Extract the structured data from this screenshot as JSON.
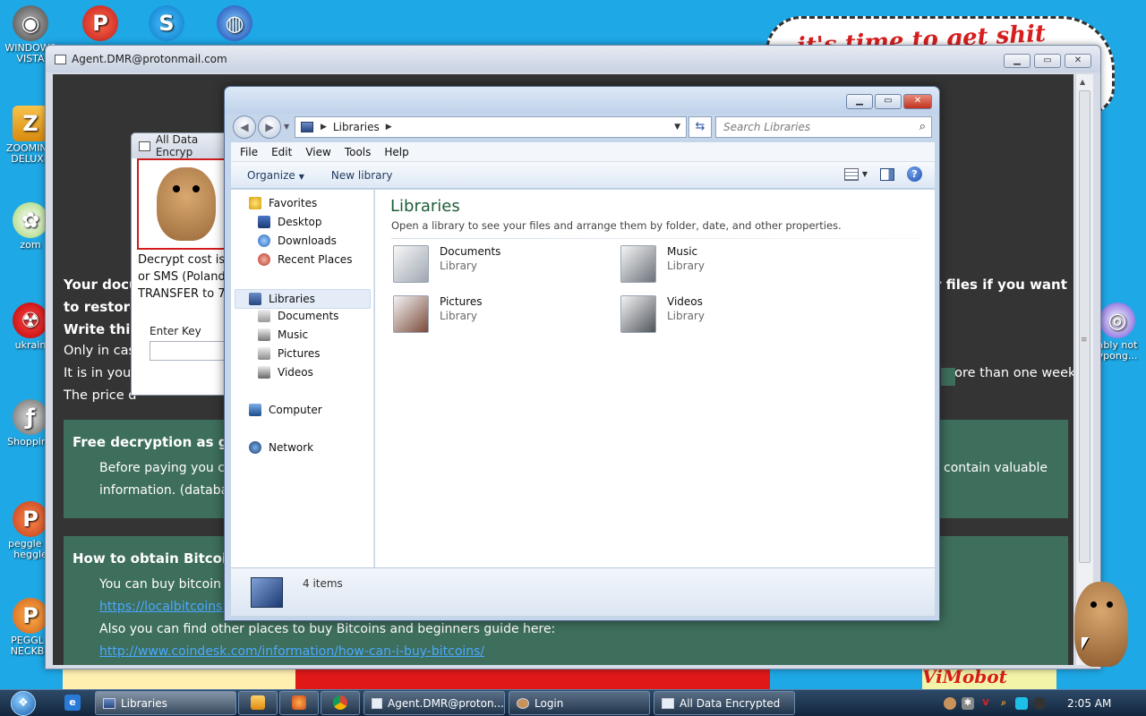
{
  "desktop": {
    "icons": [
      {
        "label": "WINDOWS\nVISTA",
        "name": "windows-vista"
      },
      {
        "label": "",
        "name": "peggle"
      },
      {
        "label": "",
        "name": "skype"
      },
      {
        "label": "",
        "name": "ie-globe"
      },
      {
        "label": "ZOOMING\nDELUXE",
        "name": "zooming-deluxe"
      },
      {
        "label": "zom",
        "name": "zom"
      },
      {
        "label": "ukrain",
        "name": "ukrain"
      },
      {
        "label": "Shopping",
        "name": "shopping"
      },
      {
        "label": "peggle w\nheggle",
        "name": "peggle-heggle"
      },
      {
        "label": "PEGGLE\nNECKBE",
        "name": "peggle-neckbe"
      },
      {
        "label": "ably not\nypong...",
        "name": "ypong"
      }
    ],
    "wallpaper_text_top": "it's time to get shit",
    "wallpaper_text_bottom": "ViMobot"
  },
  "ransom_window": {
    "title": "Agent.DMR@protonmail.com",
    "lines": [
      {
        "text": "Your docu",
        "bold": true
      },
      {
        "text": "to restore",
        "bold": true
      },
      {
        "text": "Write this",
        "bold": true
      },
      {
        "text": "Only in case"
      },
      {
        "text": "It is in your"
      },
      {
        "text": "The price d"
      },
      {
        "text": "r files if you want",
        "bold": true
      },
      {
        "text": "more than one week."
      }
    ],
    "panel1": {
      "heading": "Free decryption as gua",
      "line1": "Before paying you ca",
      "line2": "information. (databas",
      "line1_end": "contain valuable"
    },
    "panel2": {
      "heading": "How to obtain Bitcoins",
      "line1": "You can buy bitcoin fi",
      "link1": "https://localbitcoins.com",
      "line2": "Also you can find other places to buy Bitcoins and beginners guide here:",
      "link2": "http://www.coindesk.com/information/how-can-i-buy-bitcoins/"
    }
  },
  "small_window": {
    "title": "All Data Encryp",
    "text1": "Decrypt cost is 2",
    "text2": "or SMS (Poland",
    "text3": "TRANSFER to 77",
    "enter_key_label": "Enter Key"
  },
  "explorer": {
    "address": "Libraries",
    "search_placeholder": "Search Libraries",
    "menu": [
      "File",
      "Edit",
      "View",
      "Tools",
      "Help"
    ],
    "organize": "Organize",
    "new_library": "New library",
    "nav": {
      "favorites": "Favorites",
      "desktop": "Desktop",
      "downloads": "Downloads",
      "recent": "Recent Places",
      "libraries": "Libraries",
      "documents": "Documents",
      "music": "Music",
      "pictures": "Pictures",
      "videos": "Videos",
      "computer": "Computer",
      "network": "Network"
    },
    "content": {
      "title": "Libraries",
      "subtitle": "Open a library to see your files and arrange them by folder, date, and other properties.",
      "libraries": [
        {
          "name": "Documents",
          "type": "Library"
        },
        {
          "name": "Music",
          "type": "Library"
        },
        {
          "name": "Pictures",
          "type": "Library"
        },
        {
          "name": "Videos",
          "type": "Library"
        }
      ]
    },
    "status": "4 items"
  },
  "taskbar": {
    "tasks": [
      {
        "label": "Libraries",
        "active": true
      },
      {
        "label": "Agent.DMR@proton...",
        "active": false
      },
      {
        "label": "Login",
        "active": false
      },
      {
        "label": "All Data Encrypted",
        "active": false
      }
    ],
    "clock": "2:05 AM"
  }
}
